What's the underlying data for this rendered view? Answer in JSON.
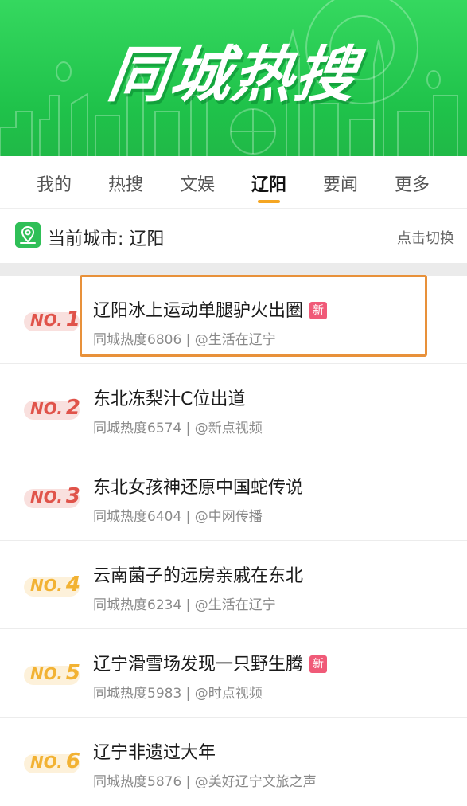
{
  "banner": {
    "title": "同城热搜",
    "background_color": "#20c24b"
  },
  "tabs": [
    {
      "label": "我的",
      "active": false
    },
    {
      "label": "热搜",
      "active": false
    },
    {
      "label": "文娱",
      "active": false
    },
    {
      "label": "辽阳",
      "active": true
    },
    {
      "label": "要闻",
      "active": false
    },
    {
      "label": "更多",
      "active": false
    }
  ],
  "city_bar": {
    "icon": "map-pin-icon",
    "current_city_text": "当前城市: 辽阳",
    "switch_label": "点击切换"
  },
  "hot_list": [
    {
      "rank_prefix": "NO.",
      "rank": "1",
      "title": "辽阳冰上运动单腿驴火出圈",
      "badge": "新",
      "meta": "同城热度6806 | @生活在辽宁",
      "highlighted": true,
      "rank_color": "#e0534a"
    },
    {
      "rank_prefix": "NO.",
      "rank": "2",
      "title": "东北冻梨汁C位出道",
      "badge": "",
      "meta": "同城热度6574 | @新点视频",
      "highlighted": false,
      "rank_color": "#e0534a"
    },
    {
      "rank_prefix": "NO.",
      "rank": "3",
      "title": "东北女孩神还原中国蛇传说",
      "badge": "",
      "meta": "同城热度6404 | @中网传播",
      "highlighted": false,
      "rank_color": "#e0534a"
    },
    {
      "rank_prefix": "NO.",
      "rank": "4",
      "title": "云南菌子的远房亲戚在东北",
      "badge": "",
      "meta": "同城热度6234 | @生活在辽宁",
      "highlighted": false,
      "rank_color": "#f2b233"
    },
    {
      "rank_prefix": "NO.",
      "rank": "5",
      "title": "辽宁滑雪场发现一只野生腾",
      "badge": "新",
      "meta": "同城热度5983 | @时点视频",
      "highlighted": false,
      "rank_color": "#f2b233"
    },
    {
      "rank_prefix": "NO.",
      "rank": "6",
      "title": "辽宁非遗过大年",
      "badge": "",
      "meta": "同城热度5876 | @美好辽宁文旅之声",
      "highlighted": false,
      "rank_color": "#f2b233"
    }
  ],
  "colors": {
    "accent_tab_underline": "#f5a623",
    "new_badge": "#f05a78",
    "highlight_border": "#e8913a"
  }
}
